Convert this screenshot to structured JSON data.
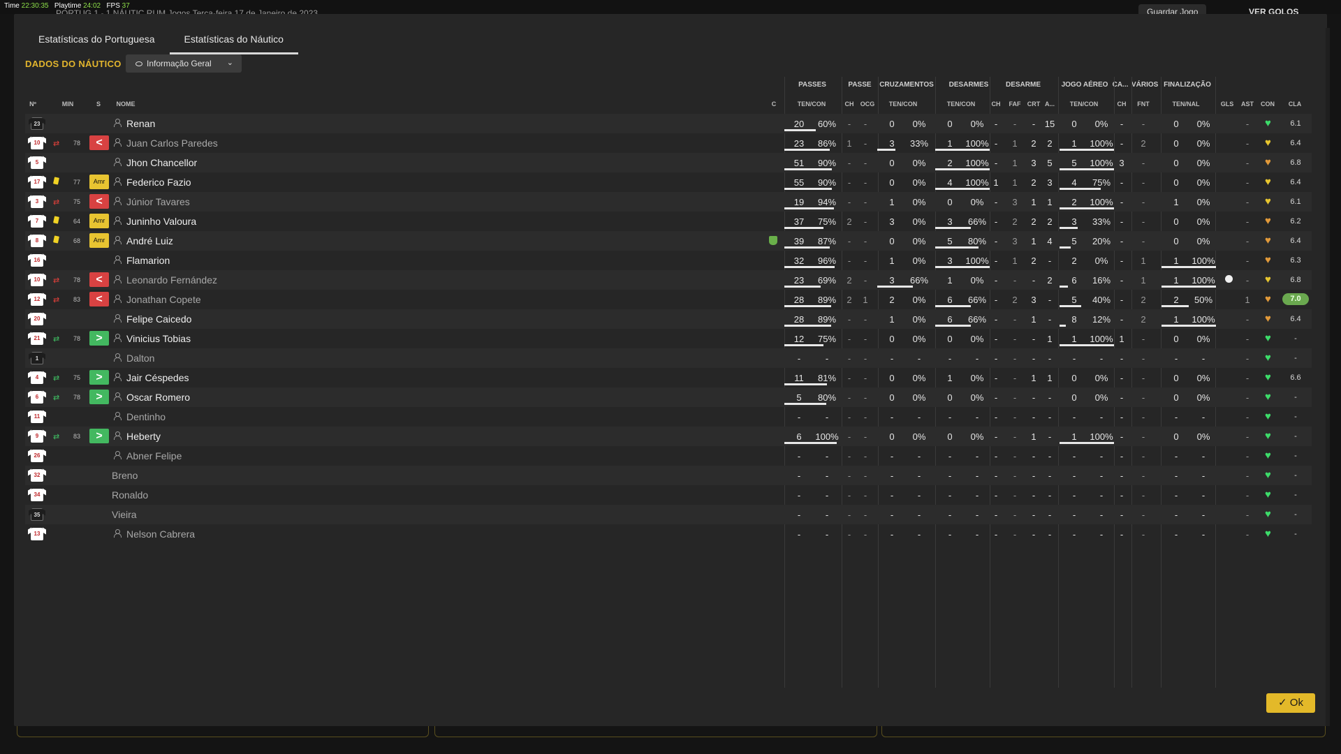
{
  "debug": {
    "time_label": "Time",
    "time": "22:30:35",
    "playtime_label": "Playtime",
    "playtime": "24:02",
    "fps_label": "FPS",
    "fps": "37"
  },
  "background": {
    "match_fragment": "PORTUG  1 - 1  NÁUTIC   RUM Jogos   Terça-feira 17 de Janeiro de 2023",
    "save_button": "Guardar Jogo",
    "goals_button": "VER GOLOS"
  },
  "tabs": [
    {
      "label": "Estatísticas do Portuguesa"
    },
    {
      "label": "Estatísticas do Náutico"
    }
  ],
  "section_title": "DADOS DO NÁUTICO",
  "view_dropdown": {
    "selected": "Informação Geral"
  },
  "group_headers": [
    "PASSES",
    "PASSE",
    "CRUZAMENTOS",
    "DESARMES",
    "DESARME",
    "JOGO AÉREO",
    "CA...",
    "VÁRIOS",
    "FINALIZAÇÃO"
  ],
  "column_headers": {
    "num": "Nº",
    "min": "MIN",
    "s": "S",
    "name": "NOME",
    "c": "C",
    "passes": "TEN/CON",
    "passe_ch": "CH",
    "passe_ocg": "OCG",
    "cross": "TEN/CON",
    "tackles": "TEN/CON",
    "des_ch": "CH",
    "des_faf": "FAF",
    "des_crt": "CRT",
    "des_a": "A...",
    "aerial": "TEN/CON",
    "ca_ch": "CH",
    "var_fnt": "FNT",
    "fin": "TEN/NAL",
    "gls": "GLS",
    "ast": "AST",
    "con": "CON",
    "cla": "CLA"
  },
  "players": [
    {
      "num": "23",
      "gk": true,
      "event": "",
      "min": "",
      "badge": "",
      "person": true,
      "name": "Renan",
      "dim": false,
      "passes": [
        "20",
        "60%"
      ],
      "passes_pct": 0.6,
      "pch": "-",
      "ocg": "-",
      "cross": [
        "0",
        "0%"
      ],
      "cross_pct": 0,
      "tackles": [
        "0",
        "0%"
      ],
      "tackles_pct": 0,
      "dch": "-",
      "faf": "-",
      "crt": "-",
      "a": "15",
      "aerial": [
        "0",
        "0%"
      ],
      "aerial_pct": 0,
      "cach": "-",
      "fnt": "-",
      "fin": [
        "0",
        "0%"
      ],
      "fin_pct": 0,
      "gls": "",
      "ast": "-",
      "con": "green",
      "cla": "6.1",
      "best": false
    },
    {
      "num": "10",
      "gk": false,
      "event": "sub-out",
      "min": "78",
      "badge": "out",
      "person": true,
      "name": "Juan Carlos Paredes",
      "dim": true,
      "passes": [
        "23",
        "86%"
      ],
      "passes_pct": 0.86,
      "pch": "1",
      "ocg": "-",
      "cross": [
        "3",
        "33%"
      ],
      "cross_pct": 0.33,
      "tackles": [
        "1",
        "100%"
      ],
      "tackles_pct": 1,
      "dch": "-",
      "faf": "1",
      "crt": "2",
      "a": "2",
      "aerial": [
        "1",
        "100%"
      ],
      "aerial_pct": 1,
      "cach": "-",
      "fnt": "2",
      "fin": [
        "0",
        "0%"
      ],
      "fin_pct": 0,
      "gls": "",
      "ast": "-",
      "con": "yellow",
      "cla": "6.4",
      "best": false
    },
    {
      "num": "5",
      "gk": false,
      "event": "",
      "min": "",
      "badge": "",
      "person": true,
      "name": "Jhon Chancellor",
      "dim": false,
      "passes": [
        "51",
        "90%"
      ],
      "passes_pct": 0.9,
      "pch": "-",
      "ocg": "-",
      "cross": [
        "0",
        "0%"
      ],
      "cross_pct": 0,
      "tackles": [
        "2",
        "100%"
      ],
      "tackles_pct": 1,
      "dch": "-",
      "faf": "1",
      "crt": "3",
      "a": "5",
      "aerial": [
        "5",
        "100%"
      ],
      "aerial_pct": 1,
      "cach": "3",
      "fnt": "-",
      "fin": [
        "0",
        "0%"
      ],
      "fin_pct": 0,
      "gls": "",
      "ast": "-",
      "con": "orange",
      "cla": "6.8",
      "best": false
    },
    {
      "num": "17",
      "gk": false,
      "event": "card",
      "min": "77",
      "badge": "amr",
      "person": true,
      "name": "Federico Fazio",
      "dim": false,
      "passes": [
        "55",
        "90%"
      ],
      "passes_pct": 0.9,
      "pch": "-",
      "ocg": "-",
      "cross": [
        "0",
        "0%"
      ],
      "cross_pct": 0,
      "tackles": [
        "4",
        "100%"
      ],
      "tackles_pct": 1,
      "dch": "1",
      "faf": "1",
      "crt": "2",
      "a": "3",
      "aerial": [
        "4",
        "75%"
      ],
      "aerial_pct": 0.75,
      "cach": "-",
      "fnt": "-",
      "fin": [
        "0",
        "0%"
      ],
      "fin_pct": 0,
      "gls": "",
      "ast": "-",
      "con": "yellow",
      "cla": "6.4",
      "best": false
    },
    {
      "num": "3",
      "gk": false,
      "event": "sub-out",
      "min": "75",
      "badge": "out",
      "person": true,
      "name": "Júnior Tavares",
      "dim": true,
      "passes": [
        "19",
        "94%"
      ],
      "passes_pct": 0.94,
      "pch": "-",
      "ocg": "-",
      "cross": [
        "1",
        "0%"
      ],
      "cross_pct": 0,
      "tackles": [
        "0",
        "0%"
      ],
      "tackles_pct": 0,
      "dch": "-",
      "faf": "3",
      "crt": "1",
      "a": "1",
      "aerial": [
        "2",
        "100%"
      ],
      "aerial_pct": 1,
      "cach": "-",
      "fnt": "-",
      "fin": [
        "1",
        "0%"
      ],
      "fin_pct": 0,
      "gls": "",
      "ast": "-",
      "con": "yellow",
      "cla": "6.1",
      "best": false
    },
    {
      "num": "7",
      "gk": false,
      "event": "card",
      "min": "64",
      "badge": "amr",
      "person": true,
      "name": "Juninho Valoura",
      "dim": false,
      "passes": [
        "37",
        "75%"
      ],
      "passes_pct": 0.75,
      "pch": "2",
      "ocg": "-",
      "cross": [
        "3",
        "0%"
      ],
      "cross_pct": 0,
      "tackles": [
        "3",
        "66%"
      ],
      "tackles_pct": 0.66,
      "dch": "-",
      "faf": "2",
      "crt": "2",
      "a": "2",
      "aerial": [
        "3",
        "33%"
      ],
      "aerial_pct": 0.33,
      "cach": "-",
      "fnt": "-",
      "fin": [
        "0",
        "0%"
      ],
      "fin_pct": 0,
      "gls": "",
      "ast": "-",
      "con": "orange",
      "cla": "6.2",
      "best": false
    },
    {
      "num": "8",
      "gk": false,
      "event": "card",
      "min": "68",
      "badge": "amr",
      "person": true,
      "name": "André Luiz",
      "dim": false,
      "cup": true,
      "passes": [
        "39",
        "87%"
      ],
      "passes_pct": 0.87,
      "pch": "-",
      "ocg": "-",
      "cross": [
        "0",
        "0%"
      ],
      "cross_pct": 0,
      "tackles": [
        "5",
        "80%"
      ],
      "tackles_pct": 0.8,
      "dch": "-",
      "faf": "3",
      "crt": "1",
      "a": "4",
      "aerial": [
        "5",
        "20%"
      ],
      "aerial_pct": 0.2,
      "cach": "-",
      "fnt": "-",
      "fin": [
        "0",
        "0%"
      ],
      "fin_pct": 0,
      "gls": "",
      "ast": "-",
      "con": "orange",
      "cla": "6.4",
      "best": false
    },
    {
      "num": "16",
      "gk": false,
      "event": "",
      "min": "",
      "badge": "",
      "person": true,
      "name": "Flamarion",
      "dim": false,
      "passes": [
        "32",
        "96%"
      ],
      "passes_pct": 0.96,
      "pch": "-",
      "ocg": "-",
      "cross": [
        "1",
        "0%"
      ],
      "cross_pct": 0,
      "tackles": [
        "3",
        "100%"
      ],
      "tackles_pct": 1,
      "dch": "-",
      "faf": "1",
      "crt": "2",
      "a": "-",
      "aerial": [
        "2",
        "0%"
      ],
      "aerial_pct": 0,
      "cach": "-",
      "fnt": "1",
      "fin": [
        "1",
        "100%"
      ],
      "fin_pct": 1,
      "gls": "",
      "ast": "-",
      "con": "orange",
      "cla": "6.3",
      "best": false
    },
    {
      "num": "10",
      "gk": false,
      "event": "sub-out",
      "min": "78",
      "badge": "out",
      "person": true,
      "name": "Leonardo Fernández",
      "dim": true,
      "passes": [
        "23",
        "69%"
      ],
      "passes_pct": 0.69,
      "pch": "2",
      "ocg": "-",
      "cross": [
        "3",
        "66%"
      ],
      "cross_pct": 0.66,
      "tackles": [
        "1",
        "0%"
      ],
      "tackles_pct": 0,
      "dch": "-",
      "faf": "-",
      "crt": "-",
      "a": "2",
      "aerial": [
        "6",
        "16%"
      ],
      "aerial_pct": 0.16,
      "cach": "-",
      "fnt": "1",
      "fin": [
        "1",
        "100%"
      ],
      "fin_pct": 1,
      "gls": "ball",
      "ast": "-",
      "con": "yellow",
      "cla": "6.8",
      "best": false
    },
    {
      "num": "12",
      "gk": false,
      "event": "sub-out",
      "min": "83",
      "badge": "out",
      "person": true,
      "name": "Jonathan Copete",
      "dim": true,
      "passes": [
        "28",
        "89%"
      ],
      "passes_pct": 0.89,
      "pch": "2",
      "ocg": "1",
      "cross": [
        "2",
        "0%"
      ],
      "cross_pct": 0,
      "tackles": [
        "6",
        "66%"
      ],
      "tackles_pct": 0.66,
      "dch": "-",
      "faf": "2",
      "crt": "3",
      "a": "-",
      "aerial": [
        "5",
        "40%"
      ],
      "aerial_pct": 0.4,
      "cach": "-",
      "fnt": "2",
      "fin": [
        "2",
        "50%"
      ],
      "fin_pct": 0.5,
      "gls": "",
      "ast": "1",
      "con": "orange",
      "cla": "7.0",
      "best": true
    },
    {
      "num": "20",
      "gk": false,
      "event": "",
      "min": "",
      "badge": "",
      "person": true,
      "name": "Felipe Caicedo",
      "dim": false,
      "passes": [
        "28",
        "89%"
      ],
      "passes_pct": 0.89,
      "pch": "-",
      "ocg": "-",
      "cross": [
        "1",
        "0%"
      ],
      "cross_pct": 0,
      "tackles": [
        "6",
        "66%"
      ],
      "tackles_pct": 0.66,
      "dch": "-",
      "faf": "-",
      "crt": "1",
      "a": "-",
      "aerial": [
        "8",
        "12%"
      ],
      "aerial_pct": 0.12,
      "cach": "-",
      "fnt": "2",
      "fin": [
        "1",
        "100%"
      ],
      "fin_pct": 1,
      "gls": "",
      "ast": "-",
      "con": "orange",
      "cla": "6.4",
      "best": false
    },
    {
      "num": "21",
      "gk": false,
      "event": "sub-in",
      "min": "78",
      "badge": "in",
      "person": true,
      "name": "Vinicius Tobias",
      "dim": false,
      "passes": [
        "12",
        "75%"
      ],
      "passes_pct": 0.75,
      "pch": "-",
      "ocg": "-",
      "cross": [
        "0",
        "0%"
      ],
      "cross_pct": 0,
      "tackles": [
        "0",
        "0%"
      ],
      "tackles_pct": 0,
      "dch": "-",
      "faf": "-",
      "crt": "-",
      "a": "1",
      "aerial": [
        "1",
        "100%"
      ],
      "aerial_pct": 1,
      "cach": "1",
      "fnt": "-",
      "fin": [
        "0",
        "0%"
      ],
      "fin_pct": 0,
      "gls": "",
      "ast": "-",
      "con": "green",
      "cla": "-",
      "best": false
    },
    {
      "num": "1",
      "gk": true,
      "event": "",
      "min": "",
      "badge": "",
      "person": true,
      "name": "Dalton",
      "dim": true,
      "passes": [
        "-",
        "-"
      ],
      "passes_pct": 0,
      "pch": "-",
      "ocg": "-",
      "cross": [
        "-",
        "-"
      ],
      "cross_pct": 0,
      "tackles": [
        "-",
        "-"
      ],
      "tackles_pct": 0,
      "dch": "-",
      "faf": "-",
      "crt": "-",
      "a": "-",
      "aerial": [
        "-",
        "-"
      ],
      "aerial_pct": 0,
      "cach": "-",
      "fnt": "-",
      "fin": [
        "-",
        "-"
      ],
      "fin_pct": 0,
      "gls": "",
      "ast": "-",
      "con": "green",
      "cla": "-",
      "best": false
    },
    {
      "num": "4",
      "gk": false,
      "event": "sub-in",
      "min": "75",
      "badge": "in",
      "person": true,
      "name": "Jair Céspedes",
      "dim": false,
      "passes": [
        "11",
        "81%"
      ],
      "passes_pct": 0.81,
      "pch": "-",
      "ocg": "-",
      "cross": [
        "0",
        "0%"
      ],
      "cross_pct": 0,
      "tackles": [
        "1",
        "0%"
      ],
      "tackles_pct": 0,
      "dch": "-",
      "faf": "-",
      "crt": "1",
      "a": "1",
      "aerial": [
        "0",
        "0%"
      ],
      "aerial_pct": 0,
      "cach": "-",
      "fnt": "-",
      "fin": [
        "0",
        "0%"
      ],
      "fin_pct": 0,
      "gls": "",
      "ast": "-",
      "con": "green",
      "cla": "6.6",
      "best": false
    },
    {
      "num": "6",
      "gk": false,
      "event": "sub-in",
      "min": "78",
      "badge": "in",
      "person": true,
      "name": "Oscar Romero",
      "dim": false,
      "passes": [
        "5",
        "80%"
      ],
      "passes_pct": 0.8,
      "pch": "-",
      "ocg": "-",
      "cross": [
        "0",
        "0%"
      ],
      "cross_pct": 0,
      "tackles": [
        "0",
        "0%"
      ],
      "tackles_pct": 0,
      "dch": "-",
      "faf": "-",
      "crt": "-",
      "a": "-",
      "aerial": [
        "0",
        "0%"
      ],
      "aerial_pct": 0,
      "cach": "-",
      "fnt": "-",
      "fin": [
        "0",
        "0%"
      ],
      "fin_pct": 0,
      "gls": "",
      "ast": "-",
      "con": "green",
      "cla": "-",
      "best": false
    },
    {
      "num": "11",
      "gk": false,
      "event": "",
      "min": "",
      "badge": "",
      "person": true,
      "name": "Dentinho",
      "dim": true,
      "passes": [
        "-",
        "-"
      ],
      "passes_pct": 0,
      "pch": "-",
      "ocg": "-",
      "cross": [
        "-",
        "-"
      ],
      "cross_pct": 0,
      "tackles": [
        "-",
        "-"
      ],
      "tackles_pct": 0,
      "dch": "-",
      "faf": "-",
      "crt": "-",
      "a": "-",
      "aerial": [
        "-",
        "-"
      ],
      "aerial_pct": 0,
      "cach": "-",
      "fnt": "-",
      "fin": [
        "-",
        "-"
      ],
      "fin_pct": 0,
      "gls": "",
      "ast": "-",
      "con": "green",
      "cla": "-",
      "best": false
    },
    {
      "num": "9",
      "gk": false,
      "event": "sub-in",
      "min": "83",
      "badge": "in",
      "person": true,
      "name": "Heberty",
      "dim": false,
      "passes": [
        "6",
        "100%"
      ],
      "passes_pct": 1,
      "pch": "-",
      "ocg": "-",
      "cross": [
        "0",
        "0%"
      ],
      "cross_pct": 0,
      "tackles": [
        "0",
        "0%"
      ],
      "tackles_pct": 0,
      "dch": "-",
      "faf": "-",
      "crt": "1",
      "a": "-",
      "aerial": [
        "1",
        "100%"
      ],
      "aerial_pct": 1,
      "cach": "-",
      "fnt": "-",
      "fin": [
        "0",
        "0%"
      ],
      "fin_pct": 0,
      "gls": "",
      "ast": "-",
      "con": "green",
      "cla": "-",
      "best": false
    },
    {
      "num": "26",
      "gk": false,
      "event": "",
      "min": "",
      "badge": "",
      "person": true,
      "name": "Abner Felipe",
      "dim": true,
      "passes": [
        "-",
        "-"
      ],
      "passes_pct": 0,
      "pch": "-",
      "ocg": "-",
      "cross": [
        "-",
        "-"
      ],
      "cross_pct": 0,
      "tackles": [
        "-",
        "-"
      ],
      "tackles_pct": 0,
      "dch": "-",
      "faf": "-",
      "crt": "-",
      "a": "-",
      "aerial": [
        "-",
        "-"
      ],
      "aerial_pct": 0,
      "cach": "-",
      "fnt": "-",
      "fin": [
        "-",
        "-"
      ],
      "fin_pct": 0,
      "gls": "",
      "ast": "-",
      "con": "green",
      "cla": "-",
      "best": false
    },
    {
      "num": "32",
      "gk": false,
      "event": "",
      "min": "",
      "badge": "",
      "person": false,
      "name": "Breno",
      "dim": true,
      "passes": [
        "-",
        "-"
      ],
      "passes_pct": 0,
      "pch": "-",
      "ocg": "-",
      "cross": [
        "-",
        "-"
      ],
      "cross_pct": 0,
      "tackles": [
        "-",
        "-"
      ],
      "tackles_pct": 0,
      "dch": "-",
      "faf": "-",
      "crt": "-",
      "a": "-",
      "aerial": [
        "-",
        "-"
      ],
      "aerial_pct": 0,
      "cach": "-",
      "fnt": "-",
      "fin": [
        "-",
        "-"
      ],
      "fin_pct": 0,
      "gls": "",
      "ast": "-",
      "con": "green",
      "cla": "-",
      "best": false
    },
    {
      "num": "34",
      "gk": false,
      "event": "",
      "min": "",
      "badge": "",
      "person": false,
      "name": "Ronaldo",
      "dim": true,
      "passes": [
        "-",
        "-"
      ],
      "passes_pct": 0,
      "pch": "-",
      "ocg": "-",
      "cross": [
        "-",
        "-"
      ],
      "cross_pct": 0,
      "tackles": [
        "-",
        "-"
      ],
      "tackles_pct": 0,
      "dch": "-",
      "faf": "-",
      "crt": "-",
      "a": "-",
      "aerial": [
        "-",
        "-"
      ],
      "aerial_pct": 0,
      "cach": "-",
      "fnt": "-",
      "fin": [
        "-",
        "-"
      ],
      "fin_pct": 0,
      "gls": "",
      "ast": "-",
      "con": "green",
      "cla": "-",
      "best": false
    },
    {
      "num": "35",
      "gk": true,
      "event": "",
      "min": "",
      "badge": "",
      "person": false,
      "name": "Vieira",
      "dim": true,
      "passes": [
        "-",
        "-"
      ],
      "passes_pct": 0,
      "pch": "-",
      "ocg": "-",
      "cross": [
        "-",
        "-"
      ],
      "cross_pct": 0,
      "tackles": [
        "-",
        "-"
      ],
      "tackles_pct": 0,
      "dch": "-",
      "faf": "-",
      "crt": "-",
      "a": "-",
      "aerial": [
        "-",
        "-"
      ],
      "aerial_pct": 0,
      "cach": "-",
      "fnt": "-",
      "fin": [
        "-",
        "-"
      ],
      "fin_pct": 0,
      "gls": "",
      "ast": "-",
      "con": "green",
      "cla": "-",
      "best": false
    },
    {
      "num": "13",
      "gk": false,
      "event": "",
      "min": "",
      "badge": "",
      "person": true,
      "name": "Nelson Cabrera",
      "dim": true,
      "passes": [
        "-",
        "-"
      ],
      "passes_pct": 0,
      "pch": "-",
      "ocg": "-",
      "cross": [
        "-",
        "-"
      ],
      "cross_pct": 0,
      "tackles": [
        "-",
        "-"
      ],
      "tackles_pct": 0,
      "dch": "-",
      "faf": "-",
      "crt": "-",
      "a": "-",
      "aerial": [
        "-",
        "-"
      ],
      "aerial_pct": 0,
      "cach": "-",
      "fnt": "-",
      "fin": [
        "-",
        "-"
      ],
      "fin_pct": 0,
      "gls": "",
      "ast": "-",
      "con": "green",
      "cla": "-",
      "best": false
    }
  ],
  "badge_labels": {
    "amr": "Amr",
    "out": "<",
    "in": ">"
  },
  "condition_colors": {
    "green": "#3ddc6a",
    "yellow": "#e8c62f",
    "orange": "#e29a3a"
  },
  "ok_button": "✓ Ok"
}
